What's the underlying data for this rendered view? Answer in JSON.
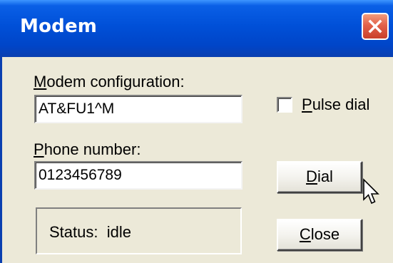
{
  "window": {
    "title": "Modem"
  },
  "form": {
    "modem_config": {
      "label_first": "M",
      "label_rest": "odem configuration:",
      "value": "AT&FU1^M"
    },
    "phone": {
      "label_first": "P",
      "label_rest": "hone number:",
      "value": "0123456789"
    },
    "pulse_dial": {
      "label_first": "P",
      "label_rest": "ulse dial",
      "checked": false
    }
  },
  "buttons": {
    "dial": {
      "first": "D",
      "rest": "ial"
    },
    "close": {
      "first": "C",
      "rest": "lose"
    }
  },
  "status": {
    "label": "Status:",
    "value": "idle"
  },
  "colors": {
    "titlebar": "#0050d8",
    "close_button": "#e2614a",
    "dialog_face": "#ece9d8"
  },
  "icons": {
    "close": "close-x-icon",
    "cursor": "mouse-pointer-icon"
  }
}
